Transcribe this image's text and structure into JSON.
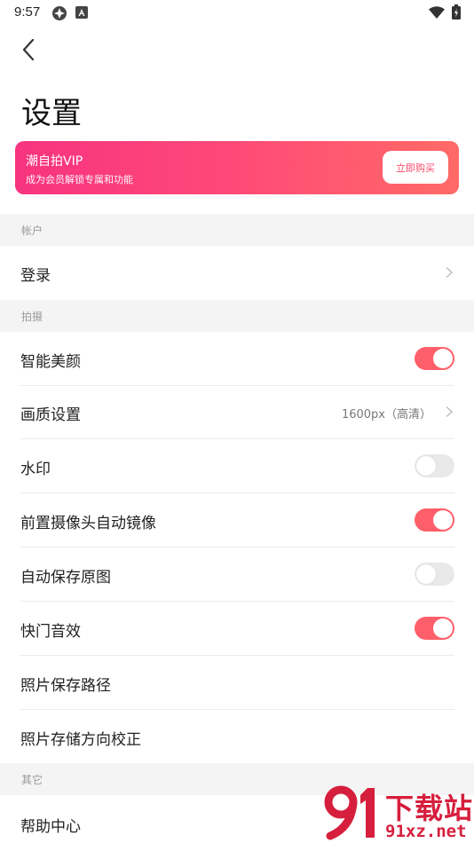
{
  "status_bar": {
    "time": "9:57",
    "icons": [
      "settings-app-icon",
      "app-a-icon",
      "wifi-icon",
      "battery-icon"
    ]
  },
  "header": {
    "back_icon": "chevron-left-icon",
    "title": "设置"
  },
  "vip_banner": {
    "title": "潮自拍VIP",
    "subtitle": "成为会员解锁专属和功能",
    "button_label": "立即购买",
    "gradient_start": "#f7337f",
    "gradient_end": "#ff6a66"
  },
  "sections": {
    "account": {
      "title": "帐户",
      "rows": {
        "login": {
          "label": "登录"
        }
      }
    },
    "shooting": {
      "title": "拍摄",
      "rows": {
        "smart_beauty": {
          "label": "智能美颜",
          "toggle": true
        },
        "quality": {
          "label": "画质设置",
          "value": "1600px（高清）"
        },
        "watermark": {
          "label": "水印",
          "toggle": false
        },
        "front_mirror": {
          "label": "前置摄像头自动镜像",
          "toggle": true
        },
        "save_original": {
          "label": "自动保存原图",
          "toggle": false
        },
        "shutter_sound": {
          "label": "快门音效",
          "toggle": true
        },
        "save_path": {
          "label": "照片保存路径"
        },
        "orientation_fix": {
          "label": "照片存储方向校正"
        }
      }
    },
    "other": {
      "title": "其它",
      "rows": {
        "help": {
          "label": "帮助中心"
        }
      }
    }
  },
  "overlay_watermark": {
    "cn_text": "下载站",
    "url_text": "91xz.net",
    "color": "#d61f3d"
  },
  "colors": {
    "toggle_on": "#ff5f6a",
    "toggle_off": "#e9e9e9",
    "section_bg": "#f4f4f4"
  }
}
